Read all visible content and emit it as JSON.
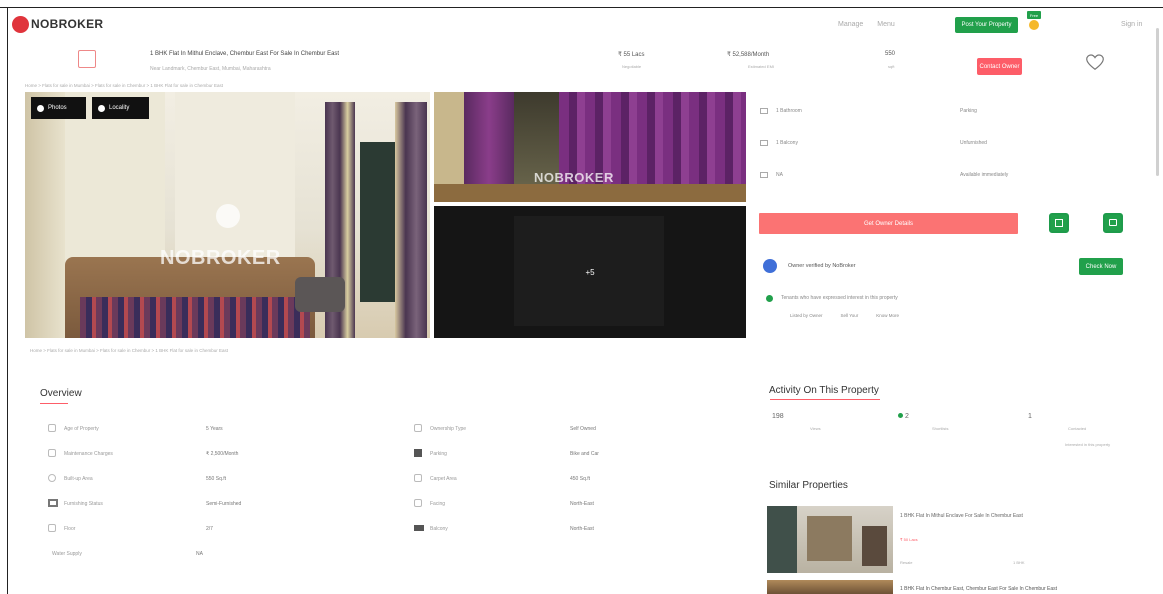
{
  "brand": {
    "name": "NOBROKER",
    "logo_color": "#e0343c"
  },
  "header": {
    "nav": [
      "Manage",
      "Menu"
    ],
    "post_property_label": "Post Your Property",
    "free_badge": "Free",
    "sign_in": "Sign in"
  },
  "listing": {
    "title": "1 BHK Flat In Mithul Enclave, Chembur East For Sale In Chembur East",
    "address": "Near Landmark, Chembur East, Mumbai, Maharashtra",
    "price_label": "₹ 55 Lacs",
    "price_sub": "Negotiable",
    "emi_label": "₹ 52,588/Month",
    "emi_sub": "Estimated EMI",
    "area_label": "550",
    "area_sub": "sqft",
    "contact_button": "Contact Owner"
  },
  "breadcrumb": "Home > Flats for sale in Mumbai > Flats for sale in Chembur > 1 BHK Flat for sale in Chembur East",
  "gallery": {
    "buttons": [
      "Photos",
      "Locality"
    ],
    "watermark": "NOBROKER",
    "more_count": "+5"
  },
  "quick_facts": [
    {
      "label": "1 Bathroom",
      "value": "Parking"
    },
    {
      "label": "1 Balcony",
      "value": "Unfurnished"
    },
    {
      "label": "NA",
      "value": "Available immediately"
    }
  ],
  "cta": {
    "owner_details_label": "Get Owner Details",
    "calendar_icon": "calendar-icon",
    "chat_icon": "chat-icon"
  },
  "owner": {
    "verified_text": "Owner verified by NoBroker",
    "check_now": "Check Now",
    "notice": "Tenants who have expressed interest in this property",
    "links": [
      "Listed by Owner",
      "Sell Your",
      "Know More"
    ]
  },
  "overview": {
    "title": "Overview",
    "rows": [
      {
        "l1": "Age of Property",
        "v1": "5 Years",
        "l2": "Ownership Type",
        "v2": "Self Owned"
      },
      {
        "l1": "Maintenance Charges",
        "v1": "₹ 2,500/Month",
        "l2": "Parking",
        "v2": "Bike and Car"
      },
      {
        "l1": "Built-up Area",
        "v1": "550 Sq.ft",
        "l2": "Carpet Area",
        "v2": "450 Sq.ft"
      },
      {
        "l1": "Furnishing Status",
        "v1": "Semi-Furnished",
        "l2": "Facing",
        "v2": "North-East"
      },
      {
        "l1": "Floor",
        "v1": "2/7",
        "l2": "Balcony",
        "v2": "North-East"
      },
      {
        "l1": "Water Supply",
        "v1": "NA",
        "l2": "",
        "v2": ""
      }
    ]
  },
  "activity": {
    "title": "Activity On This Property",
    "stats": [
      {
        "value": "198",
        "label": "Views"
      },
      {
        "value": "2",
        "label": "Shortlists"
      },
      {
        "value": "1",
        "label": "Contacted"
      }
    ],
    "footer": "Interested in this property"
  },
  "similar": {
    "title": "Similar Properties",
    "items": [
      {
        "title": "1 BHK Flat In Mithul Enclave For Sale In Chembur East",
        "price": "₹ 50 Lacs",
        "meta": "Resale",
        "area": "1 BHK"
      },
      {
        "title": "1 BHK Flat In Chembur East, Chembur East For Sale In Chembur East",
        "price": "",
        "meta": "",
        "area": ""
      }
    ]
  },
  "colors": {
    "green": "#21a04b",
    "red": "#fd5d68",
    "salmon": "#fb7373",
    "blue": "#3f6fd8"
  }
}
